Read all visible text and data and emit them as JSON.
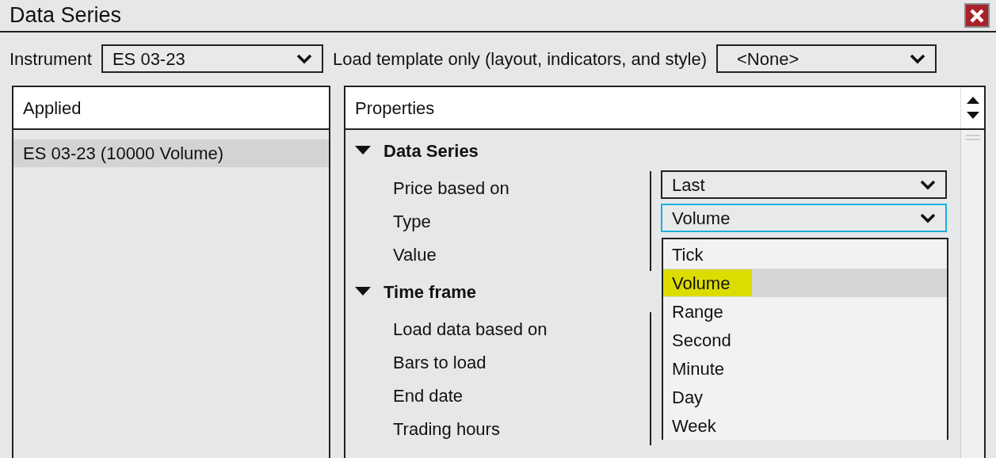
{
  "window": {
    "title": "Data Series"
  },
  "toolbar": {
    "instrument_label": "Instrument",
    "instrument_value": "ES 03-23",
    "template_label": "Load template only (layout, indicators, and style)",
    "template_value": "<None>"
  },
  "applied": {
    "header": "Applied",
    "items": [
      {
        "label": "ES 03-23 (10000 Volume)",
        "selected": true
      }
    ]
  },
  "properties": {
    "header": "Properties",
    "sections": [
      {
        "title": "Data Series",
        "expanded": true,
        "rows": [
          {
            "label": "Price based on",
            "value": "Last",
            "focused": false
          },
          {
            "label": "Type",
            "value": "Volume",
            "focused": true
          },
          {
            "label": "Value"
          }
        ]
      },
      {
        "title": "Time frame",
        "expanded": true,
        "rows": [
          {
            "label": "Load data based on"
          },
          {
            "label": "Bars to load"
          },
          {
            "label": "End date"
          },
          {
            "label": "Trading hours"
          }
        ]
      }
    ]
  },
  "dropdown": {
    "options": [
      {
        "label": "Tick",
        "selected": false,
        "highlighted": false
      },
      {
        "label": "Volume",
        "selected": true,
        "highlighted": true
      },
      {
        "label": "Range",
        "selected": false,
        "highlighted": false
      },
      {
        "label": "Second",
        "selected": false,
        "highlighted": false
      },
      {
        "label": "Minute",
        "selected": false,
        "highlighted": false
      },
      {
        "label": "Day",
        "selected": false,
        "highlighted": false
      },
      {
        "label": "Week",
        "selected": false,
        "highlighted": false
      }
    ]
  }
}
